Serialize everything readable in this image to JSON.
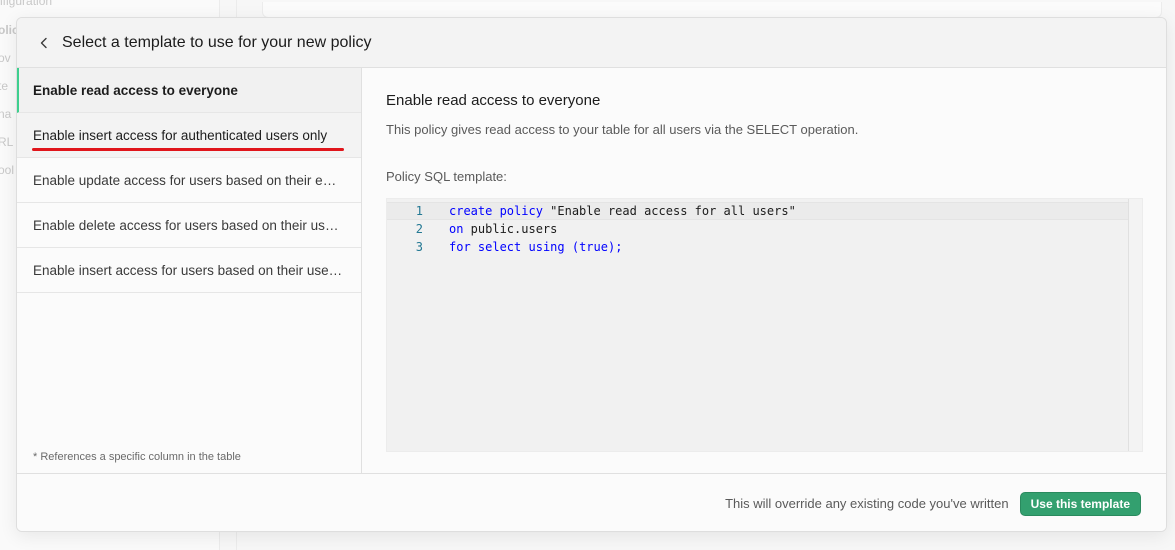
{
  "background": {
    "sidebar_fragments": [
      "nfiguration",
      "olic",
      "ov",
      "te",
      "na",
      "RL",
      "ool"
    ]
  },
  "modal": {
    "title": "Select a template to use for your new policy",
    "back_icon": "chevron-left-icon",
    "templates": [
      {
        "label": "Enable read access to everyone"
      },
      {
        "label": "Enable insert access for authenticated users only"
      },
      {
        "label": "Enable update access for users based on their email *"
      },
      {
        "label": "Enable delete access for users based on their user ID *"
      },
      {
        "label": "Enable insert access for users based on their user ID *"
      }
    ],
    "selected_index": 0,
    "footnote": "* References a specific column in the table",
    "detail": {
      "title": "Enable read access to everyone",
      "description": "This policy gives read access to your table for all users via the SELECT operation.",
      "sql_label": "Policy SQL template:",
      "code_lines": [
        {
          "no": "1",
          "tokens": [
            {
              "t": "create",
              "c": "kw"
            },
            {
              "t": " policy ",
              "c": "kw"
            },
            {
              "t": "\"Enable read access for all users\"",
              "c": "plain"
            }
          ]
        },
        {
          "no": "2",
          "tokens": [
            {
              "t": "on",
              "c": "kw"
            },
            {
              "t": " public.users",
              "c": "plain"
            }
          ]
        },
        {
          "no": "3",
          "tokens": [
            {
              "t": "for",
              "c": "kw"
            },
            {
              "t": " select",
              "c": "kw"
            },
            {
              "t": " using",
              "c": "kw"
            },
            {
              "t": " (true);",
              "c": "kw"
            }
          ]
        }
      ]
    },
    "footer": {
      "note": "This will override any existing code you've written",
      "button_label": "Use this template"
    }
  },
  "colors": {
    "accent": "#3ecf8e",
    "button_bg": "#33a06f",
    "annotation_red": "#e0151b",
    "keyword_blue": "#0000ff",
    "line_number": "#237893"
  }
}
